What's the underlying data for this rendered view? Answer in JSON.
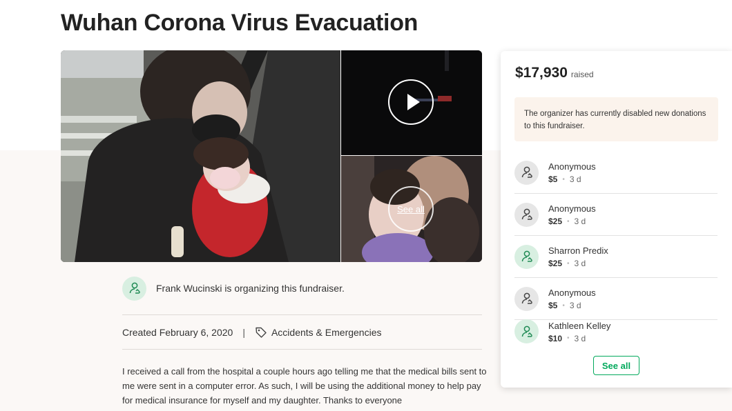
{
  "campaign": {
    "title": "Wuhan Corona Virus Evacuation"
  },
  "gallery": {
    "see_all": "See all"
  },
  "organizer": {
    "text": "Frank Wucinski is organizing this fundraiser."
  },
  "meta": {
    "created": "Created February 6, 2020",
    "separator": "|",
    "category": "Accidents & Emergencies"
  },
  "story": {
    "text": "I received a call from the hospital a couple hours ago telling me that the medical bills sent to me were sent in a computer error.  As such, I will be using the additional money to help pay for medical insurance for myself and my daughter.  Thanks to everyone"
  },
  "donation_panel": {
    "amount": "$17,930",
    "raised_label": "raised",
    "notice": "The organizer has currently disabled new donations to this fundraiser.",
    "donations": [
      {
        "name": "Anonymous",
        "amount": "$5",
        "time": "3 d",
        "avatar": "gray"
      },
      {
        "name": "Anonymous",
        "amount": "$25",
        "time": "3 d",
        "avatar": "gray"
      },
      {
        "name": "Sharron Predix",
        "amount": "$25",
        "time": "3 d",
        "avatar": "green"
      },
      {
        "name": "Anonymous",
        "amount": "$5",
        "time": "3 d",
        "avatar": "gray"
      },
      {
        "name": "Kathleen Kelley",
        "amount": "$10",
        "time": "3 d",
        "avatar": "green"
      }
    ],
    "see_all_label": "See all",
    "dot": "•"
  },
  "colors": {
    "accent_green": "#02a95c",
    "avatar_green_bg": "#d8efe1",
    "avatar_gray_bg": "#e6e6e6",
    "notice_bg": "#fbf3ec",
    "page_bg": "#fbf8f6"
  },
  "icons": {
    "organizer_avatar": "user-heart-icon",
    "category": "tag-icon",
    "video": "play-icon",
    "donor_avatar": "user-heart-icon"
  }
}
